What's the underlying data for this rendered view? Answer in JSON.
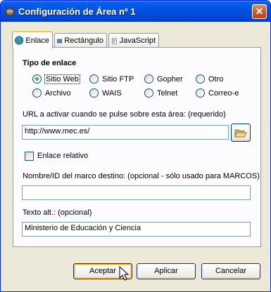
{
  "window": {
    "title": "Configuración de Área nº 1",
    "icons": {
      "app": "gimp-icon",
      "close": "close-icon"
    }
  },
  "tabs": [
    {
      "label": "Enlace",
      "icon": "globe-icon",
      "active": true
    },
    {
      "label": "Rectángulo",
      "icon": "rectangle-icon",
      "active": false
    },
    {
      "label": "JavaScript",
      "icon": "script-icon",
      "active": false
    }
  ],
  "link_type": {
    "title": "Tipo de enlace",
    "selected": "Sitio Web",
    "options": [
      "Sitio Web",
      "Sitio FTP",
      "Gopher",
      "Otro",
      "Archivo",
      "WAIS",
      "Telnet",
      "Correo-e"
    ]
  },
  "url": {
    "label": "URL a activar cuando se pulse sobre esta área: (requerido)",
    "value": "http://www.mec.es/",
    "browse_icon": "folder-open-icon"
  },
  "relative": {
    "label": "Enlace relativo",
    "checked": false
  },
  "frame": {
    "label": "Nombre/ID del marco destino: (opcional - sólo usado para MARCOS)",
    "value": ""
  },
  "alt_text": {
    "label": "Texto alt.: (opcional)",
    "value": "Ministerio de Educación y Ciencia"
  },
  "buttons": {
    "ok": "Aceptar",
    "apply": "Aplicar",
    "cancel": "Cancelar"
  },
  "colors": {
    "titlebar": "#0055e5",
    "dialog_bg": "#ece9d8",
    "panel_bg": "#fcfcfe",
    "radio_checked": "#21a117",
    "tab_highlight": "#ffc83c"
  }
}
